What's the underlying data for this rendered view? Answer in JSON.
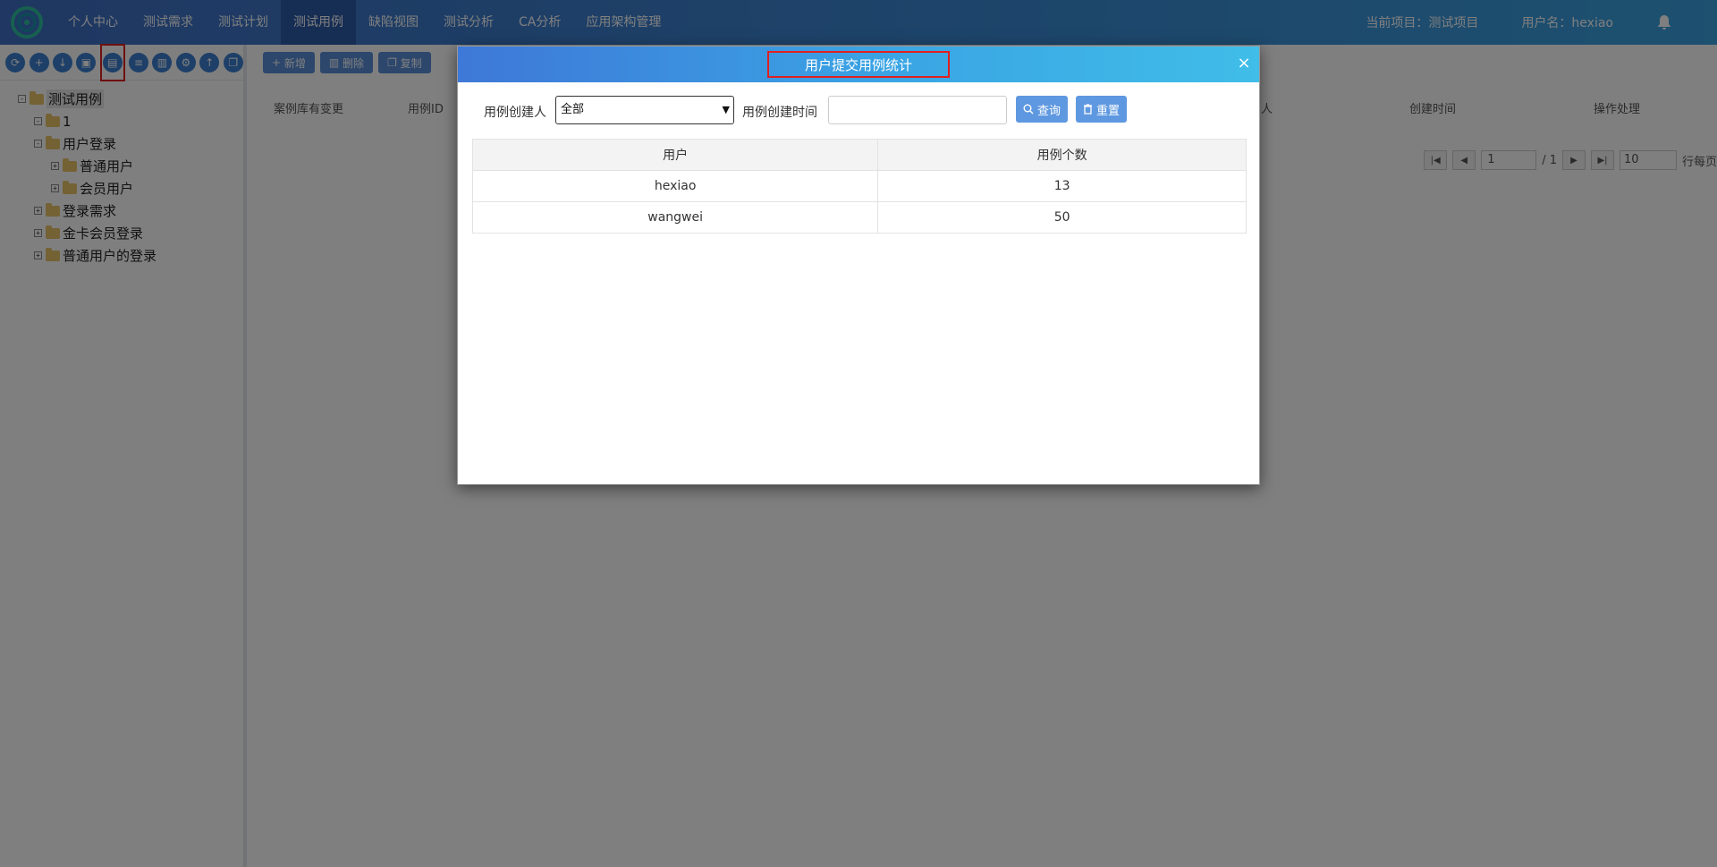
{
  "topbar": {
    "nav": [
      "个人中心",
      "测试需求",
      "测试计划",
      "测试用例",
      "缺陷视图",
      "测试分析",
      "CA分析",
      "应用架构管理"
    ],
    "active_index": 3,
    "project_text": "当前项目：测试项目",
    "user_text": "用户名：hexiao"
  },
  "tree": {
    "nodes": [
      {
        "label": "测试用例",
        "level": 0,
        "expander": "⊟"
      },
      {
        "label": "1",
        "level": 1,
        "expander": "⊟"
      },
      {
        "label": "用户登录",
        "level": 1,
        "expander": "⊟"
      },
      {
        "label": "普通用户",
        "level": 2,
        "expander": "⊞"
      },
      {
        "label": "会员用户",
        "level": 2,
        "expander": "⊞"
      },
      {
        "label": "登录需求",
        "level": 1,
        "expander": "⊞"
      },
      {
        "label": "金卡会员登录",
        "level": 1,
        "expander": "⊞"
      },
      {
        "label": "普通用户的登录",
        "level": 1,
        "expander": "⊞"
      }
    ]
  },
  "content": {
    "toolbar": [
      "新增",
      "删除",
      "复制"
    ],
    "headers": [
      "案例库有变更",
      "用例ID",
      "人",
      "创建时间",
      "操作处理"
    ],
    "pager": {
      "page": "1",
      "total": "/ 1",
      "page_size": "10",
      "rows_label": "行每页"
    }
  },
  "modal": {
    "title": "用户提交用例统计",
    "close": "×",
    "creator_label": "用例创建人",
    "creator_value": "全部",
    "time_label": "用例创建时间",
    "query_button": "查询",
    "reset_button": "重置",
    "table": {
      "columns": [
        "用户",
        "用例个数"
      ],
      "rows": [
        [
          "hexiao",
          "13"
        ],
        [
          "wangwei",
          "50"
        ]
      ]
    }
  }
}
